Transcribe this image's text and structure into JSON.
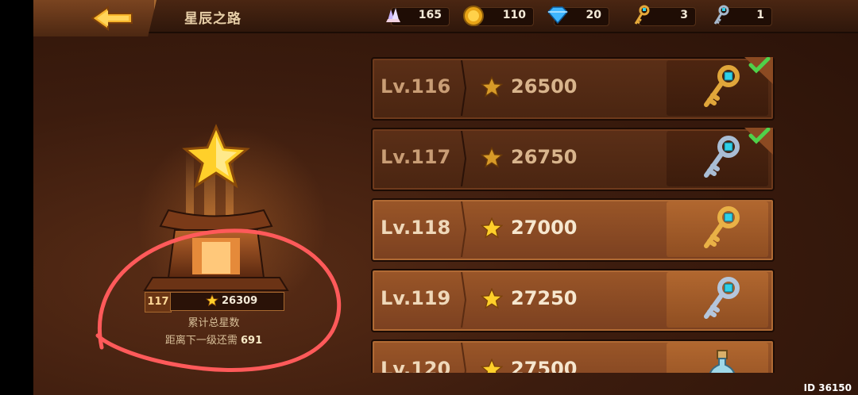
{
  "header": {
    "title": "星辰之路"
  },
  "resources": [
    {
      "icon": "crystal-icon",
      "value": "165"
    },
    {
      "icon": "coin-icon",
      "value": "110"
    },
    {
      "icon": "diamond-icon",
      "value": "20"
    },
    {
      "icon": "gold-key-icon",
      "value": "3"
    },
    {
      "icon": "silver-key-icon",
      "value": "1"
    }
  ],
  "summary": {
    "level": "117",
    "total_stars": "26309",
    "caption": "累计总星数",
    "next_prefix": "距离下一级还需",
    "next_value": "691"
  },
  "levels": [
    {
      "level": "Lv.116",
      "stars": "26500",
      "reward": "gold-key-icon",
      "claimed": true,
      "style": "dark"
    },
    {
      "level": "Lv.117",
      "stars": "26750",
      "reward": "silver-key-icon",
      "claimed": true,
      "style": "dark"
    },
    {
      "level": "Lv.118",
      "stars": "27000",
      "reward": "gold-key-icon",
      "claimed": false,
      "style": "light"
    },
    {
      "level": "Lv.119",
      "stars": "27250",
      "reward": "silver-key-icon",
      "claimed": false,
      "style": "light"
    },
    {
      "level": "Lv.120",
      "stars": "27500",
      "reward": "potion-icon",
      "claimed": false,
      "style": "light"
    }
  ],
  "footer": {
    "id_label": "ID 36150"
  },
  "colors": {
    "accent": "#f5c23a",
    "annotation": "#ff5a5a",
    "check": "#4fd24a"
  }
}
